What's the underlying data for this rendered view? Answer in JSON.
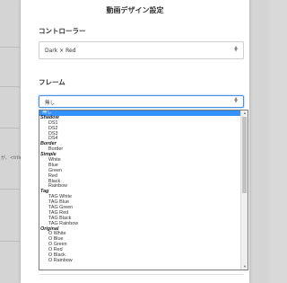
{
  "background": {
    "snippet_text": "が、<title"
  },
  "modal": {
    "title": "動画デザイン設定",
    "controller_section": {
      "label": "コントローラー",
      "selected_value": "Dark × Red"
    },
    "frame_section": {
      "label": "フレーム",
      "selected_value": "無し"
    }
  },
  "dropdown": {
    "options": [
      {
        "type": "option",
        "label": "無し",
        "selected": true
      },
      {
        "type": "group",
        "label": "Shadow"
      },
      {
        "type": "option",
        "label": "DS1"
      },
      {
        "type": "option",
        "label": "DS2"
      },
      {
        "type": "option",
        "label": "DS3"
      },
      {
        "type": "option",
        "label": "DS4"
      },
      {
        "type": "group",
        "label": "Border"
      },
      {
        "type": "option",
        "label": "Border"
      },
      {
        "type": "group",
        "label": "Simple"
      },
      {
        "type": "option",
        "label": "White"
      },
      {
        "type": "option",
        "label": "Blue"
      },
      {
        "type": "option",
        "label": "Green"
      },
      {
        "type": "option",
        "label": "Red"
      },
      {
        "type": "option",
        "label": "Black"
      },
      {
        "type": "option",
        "label": "Rainbow"
      },
      {
        "type": "group",
        "label": "Tag"
      },
      {
        "type": "option",
        "label": "TAG White"
      },
      {
        "type": "option",
        "label": "TAG Blue"
      },
      {
        "type": "option",
        "label": "TAG Green"
      },
      {
        "type": "option",
        "label": "TAG Red"
      },
      {
        "type": "option",
        "label": "TAG Black"
      },
      {
        "type": "option",
        "label": "TAG Rainbow"
      },
      {
        "type": "group",
        "label": "Original"
      },
      {
        "type": "option",
        "label": "O White"
      },
      {
        "type": "option",
        "label": "O Blue"
      },
      {
        "type": "option",
        "label": "O Green"
      },
      {
        "type": "option",
        "label": "O Red"
      },
      {
        "type": "option",
        "label": "O Black"
      },
      {
        "type": "option",
        "label": "O Rainbow"
      }
    ],
    "colors": {
      "selected_bg": "#3390ff",
      "focus_border": "#4a90e2"
    }
  }
}
